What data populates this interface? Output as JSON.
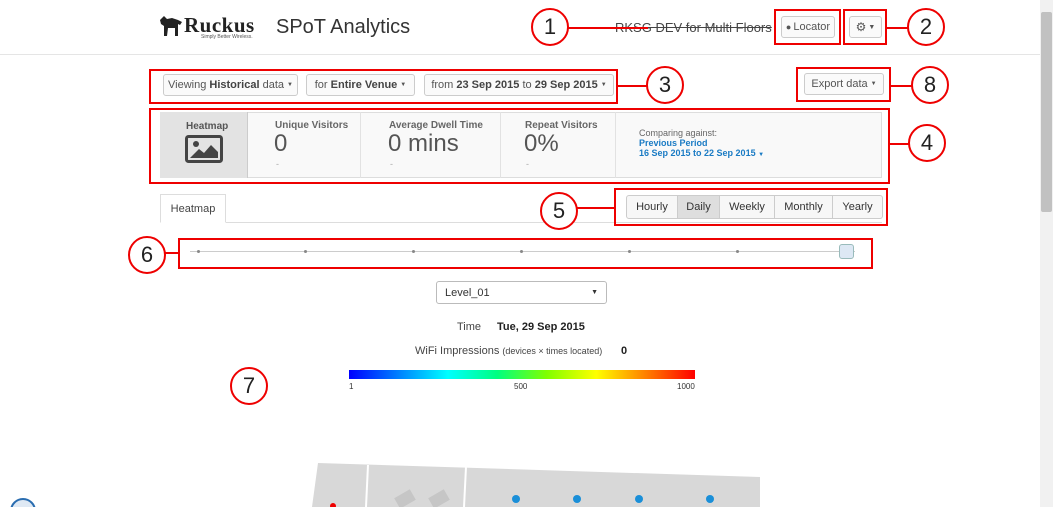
{
  "header": {
    "logo_text": "Ruckus",
    "logo_tagline": "Simply Better Wireless.",
    "app_title": "SPoT Analytics",
    "venue_name": "RKSG DEV for Multi Floors",
    "locator_label": "Locator"
  },
  "filters": {
    "viewing_prefix": "Viewing",
    "viewing_value": "Historical",
    "viewing_suffix": "data",
    "for_prefix": "for",
    "for_value": "Entire Venue",
    "from_prefix": "from",
    "date_from": "23 Sep 2015",
    "to_word": "to",
    "date_to": "29 Sep 2015",
    "export_label": "Export data"
  },
  "stats": {
    "heatmap_label": "Heatmap",
    "unique_visitors_label": "Unique Visitors",
    "unique_visitors_value": "0",
    "unique_visitors_sub": "-",
    "dwell_label": "Average Dwell Time",
    "dwell_value": "0 mins",
    "dwell_sub": "-",
    "repeat_label": "Repeat Visitors",
    "repeat_value": "0%",
    "repeat_sub": "-",
    "comparing_label": "Comparing against:",
    "comparing_period": "Previous Period",
    "comparing_range": "16 Sep 2015 to 22 Sep 2015"
  },
  "tabs": {
    "heatmap_tab": "Heatmap",
    "granularity": [
      "Hourly",
      "Daily",
      "Weekly",
      "Monthly",
      "Yearly"
    ],
    "selected": "Daily"
  },
  "slider": {
    "value_fraction": 1.0,
    "tick_count": 6
  },
  "heatmap": {
    "floor_select": "Level_01",
    "time_label": "Time",
    "time_value": "Tue, 29 Sep 2015",
    "impressions_label": "WiFi Impressions",
    "impressions_note": "(devices × times located)",
    "impressions_value": "0",
    "scale_min": "1",
    "scale_mid": "500",
    "scale_max": "1000"
  },
  "callouts": [
    "1",
    "2",
    "3",
    "4",
    "5",
    "6",
    "7",
    "8"
  ],
  "colors": {
    "callout_red": "#e00000",
    "link_blue": "#1a7bc4"
  }
}
